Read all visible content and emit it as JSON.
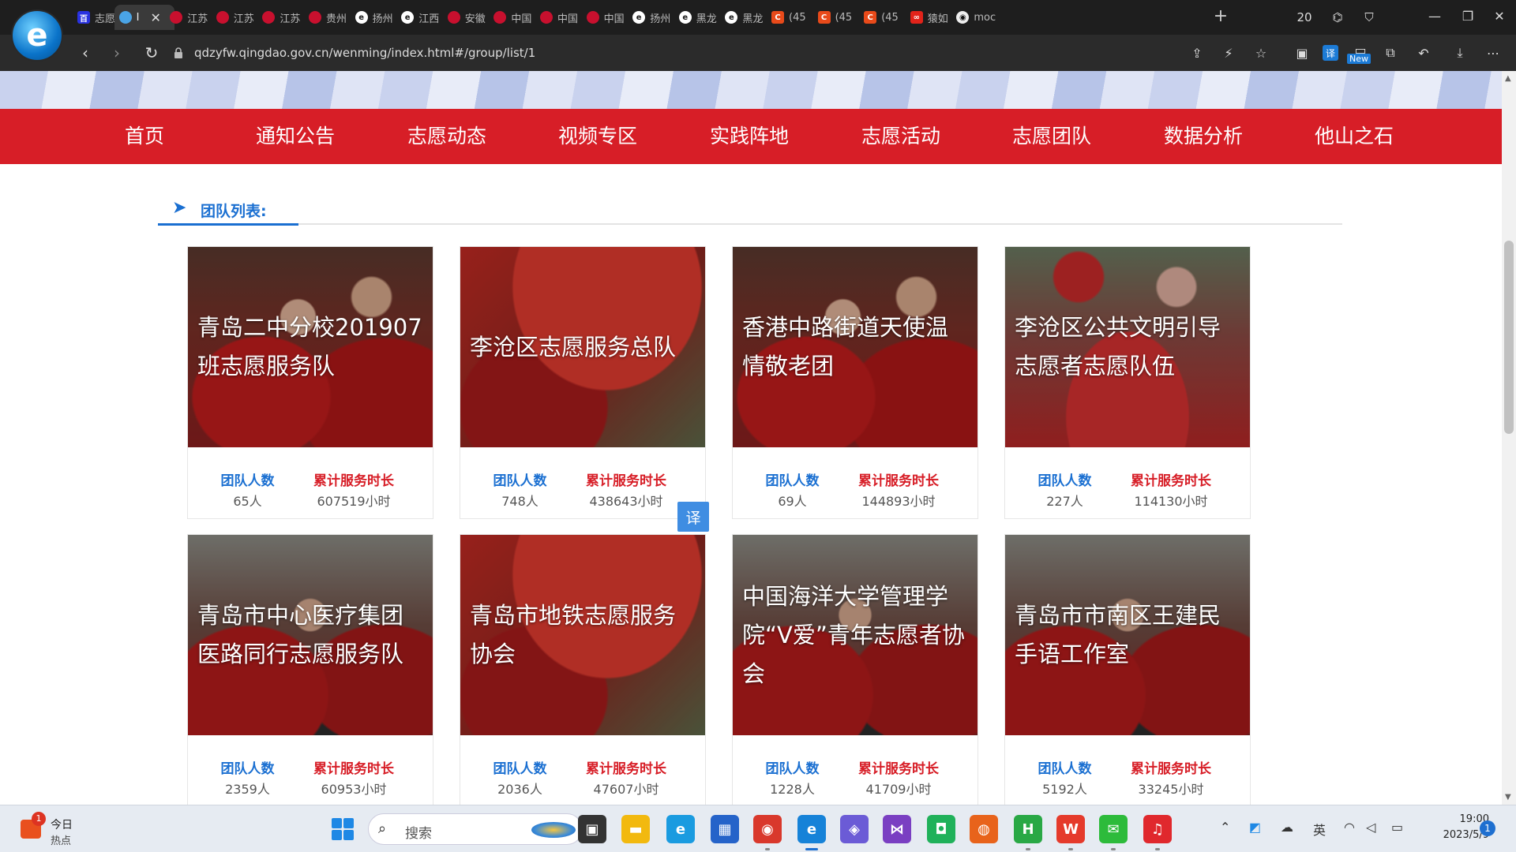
{
  "browser": {
    "logo_glyph": "e",
    "tabs": [
      {
        "title": "志愿",
        "fav": "baidu",
        "glyph": "百"
      },
      {
        "title": "I",
        "fav": "blue",
        "glyph": "",
        "active": true
      },
      {
        "title": "江苏",
        "fav": "red",
        "glyph": ""
      },
      {
        "title": "江苏",
        "fav": "red",
        "glyph": ""
      },
      {
        "title": "江苏",
        "fav": "red",
        "glyph": ""
      },
      {
        "title": "贵州",
        "fav": "red",
        "glyph": ""
      },
      {
        "title": "扬州",
        "fav": "e",
        "glyph": "e"
      },
      {
        "title": "江西",
        "fav": "e",
        "glyph": "e"
      },
      {
        "title": "安徽",
        "fav": "red",
        "glyph": ""
      },
      {
        "title": "中国",
        "fav": "red",
        "glyph": ""
      },
      {
        "title": "中国",
        "fav": "red",
        "glyph": ""
      },
      {
        "title": "中国",
        "fav": "red",
        "glyph": ""
      },
      {
        "title": "扬州",
        "fav": "e",
        "glyph": "e"
      },
      {
        "title": "黑龙",
        "fav": "e",
        "glyph": "e"
      },
      {
        "title": "黑龙",
        "fav": "e",
        "glyph": "e"
      },
      {
        "title": "(45",
        "fav": "c",
        "glyph": "C"
      },
      {
        "title": "(45",
        "fav": "c",
        "glyph": "C"
      },
      {
        "title": "(45",
        "fav": "c",
        "glyph": "C"
      },
      {
        "title": "猿如",
        "fav": "ape",
        "glyph": "∞"
      },
      {
        "title": "moc",
        "fav": "gh",
        "glyph": "◉"
      }
    ],
    "tab_close": "✕",
    "new_tab": "+",
    "url": "qdzyfw.qingdao.gov.cn/wenming/index.html#/group/list/1",
    "nav": {
      "back": "‹",
      "forward": "›",
      "reload": "↻"
    },
    "tools": {
      "share": "⇪",
      "lightning": "⚡",
      "star": "☆",
      "collections": "▣",
      "translate": "译",
      "new_badge": "New",
      "extensions": "⧉",
      "undo": "↶",
      "download": "⤓",
      "menu": "⋯"
    },
    "top_icons": {
      "sidebar": "20",
      "game": "⌬",
      "shirt": "⛉"
    },
    "window": {
      "minimize": "—",
      "restore": "❐",
      "close": "✕"
    }
  },
  "site": {
    "nav": [
      "首页",
      "通知公告",
      "志愿动态",
      "视频专区",
      "实践阵地",
      "志愿活动",
      "志愿团队",
      "数据分析",
      "他山之石"
    ],
    "section_title": "团队列表:",
    "section_arrow": "➤",
    "stat_labels": {
      "members": "团队人数",
      "hours": "累计服务时长"
    },
    "teams": [
      {
        "name": "青岛二中分校201907班志愿服务队",
        "members": "65人",
        "hours": "607519小时",
        "img": "fist"
      },
      {
        "name": "李沧区志愿服务总队",
        "members": "748人",
        "hours": "438643小时",
        "img": "flag"
      },
      {
        "name": "香港中路街道天使温情敬老团",
        "members": "69人",
        "hours": "144893小时",
        "img": "fist"
      },
      {
        "name": "李沧区公共文明引导志愿者志愿队伍",
        "members": "227人",
        "hours": "114130小时",
        "img": "sign"
      },
      {
        "name": "青岛市中心医疗集团医路同行志愿服务队",
        "members": "2359人",
        "hours": "60953小时",
        "img": "elder"
      },
      {
        "name": "青岛市地铁志愿服务协会",
        "members": "2036人",
        "hours": "47607小时",
        "img": "flag"
      },
      {
        "name": "中国海洋大学管理学院“V爱”青年志愿者协会",
        "members": "1228人",
        "hours": "41709小时",
        "img": "elder"
      },
      {
        "name": "青岛市市南区王建民手语工作室",
        "members": "5192人",
        "hours": "33245小时",
        "img": "elder"
      }
    ],
    "translate_float": "译"
  },
  "scrollbar": {
    "up": "▲",
    "down": "▼"
  },
  "taskbar": {
    "news_title": "今日",
    "news_sub": "热点",
    "news_badge": "1",
    "search_placeholder": "搜索",
    "search_icon": "⌕",
    "apps": [
      {
        "name": "task-view",
        "glyph": "▣",
        "color": "#333333"
      },
      {
        "name": "file-explorer",
        "glyph": "▬",
        "color": "#f2b90f"
      },
      {
        "name": "edge",
        "glyph": "e",
        "color": "#1a9be0"
      },
      {
        "name": "store",
        "glyph": "▦",
        "color": "#2563c9"
      },
      {
        "name": "chrome",
        "glyph": "◉",
        "color": "#d9382c"
      },
      {
        "name": "browser-e",
        "glyph": "e",
        "color": "#1682d8"
      },
      {
        "name": "copilot",
        "glyph": "◈",
        "color": "#6b5bd6"
      },
      {
        "name": "visual-studio",
        "glyph": "⋈",
        "color": "#7a3fc2"
      },
      {
        "name": "app-green",
        "glyph": "◘",
        "color": "#20b15a"
      },
      {
        "name": "firefox",
        "glyph": "◍",
        "color": "#e8631b"
      },
      {
        "name": "hbuilder",
        "glyph": "H",
        "color": "#29a845"
      },
      {
        "name": "wps",
        "glyph": "W",
        "color": "#e53a2b"
      },
      {
        "name": "wechat",
        "glyph": "✉",
        "color": "#2dbb3b"
      },
      {
        "name": "netease-music",
        "glyph": "♫",
        "color": "#e0282d"
      }
    ],
    "tray": {
      "chevron": "⌃",
      "app": "◩",
      "cloud": "☁",
      "ime": "英",
      "wifi": "◠",
      "volume": "◁",
      "battery": "▭"
    },
    "time": "19:00",
    "date": "2023/5/9",
    "notifications": "1"
  },
  "colors": {
    "nav_red": "#d71e27",
    "link_blue": "#1a6fd1"
  }
}
